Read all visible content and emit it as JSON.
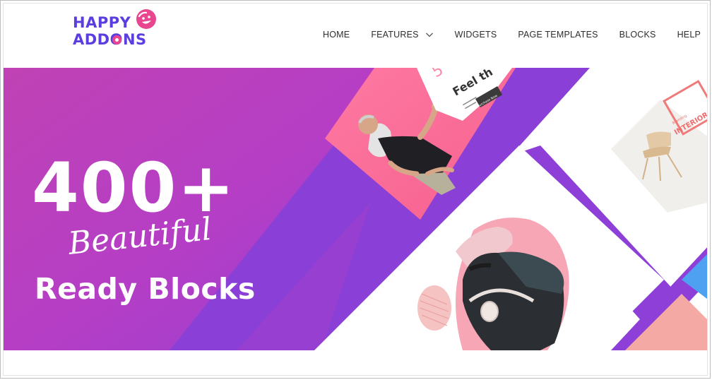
{
  "logo": {
    "line1": "HAPPY",
    "line2": "ADDONS"
  },
  "nav": {
    "items": [
      {
        "label": "HOME",
        "has_dropdown": false
      },
      {
        "label": "FEATURES",
        "has_dropdown": true
      },
      {
        "label": "WIDGETS",
        "has_dropdown": false
      },
      {
        "label": "PAGE TEMPLATES",
        "has_dropdown": false
      },
      {
        "label": "BLOCKS",
        "has_dropdown": false
      },
      {
        "label": "HELP",
        "has_dropdown": true
      }
    ]
  },
  "hero": {
    "count": "400+",
    "script": "Beautiful",
    "headline": "Ready Blocks",
    "card_top_partial": "Feel th",
    "card_number_partial": "5",
    "card_button_partial": "Purchase Now",
    "card_interior": "INTERIOR",
    "card_interior_small": "Branding"
  },
  "colors": {
    "brand_purple": "#5c3ee0",
    "brand_pink": "#e8468f",
    "hero_gradient_start": "#c23fb2",
    "hero_gradient_end": "#9b3fd0",
    "stripe_purple": "#8a3fd6",
    "pink_card": "#fb6f9a",
    "salmon_card": "#f4a4a0"
  },
  "icons": [
    "chevron-down-icon",
    "logo-face-icon"
  ]
}
